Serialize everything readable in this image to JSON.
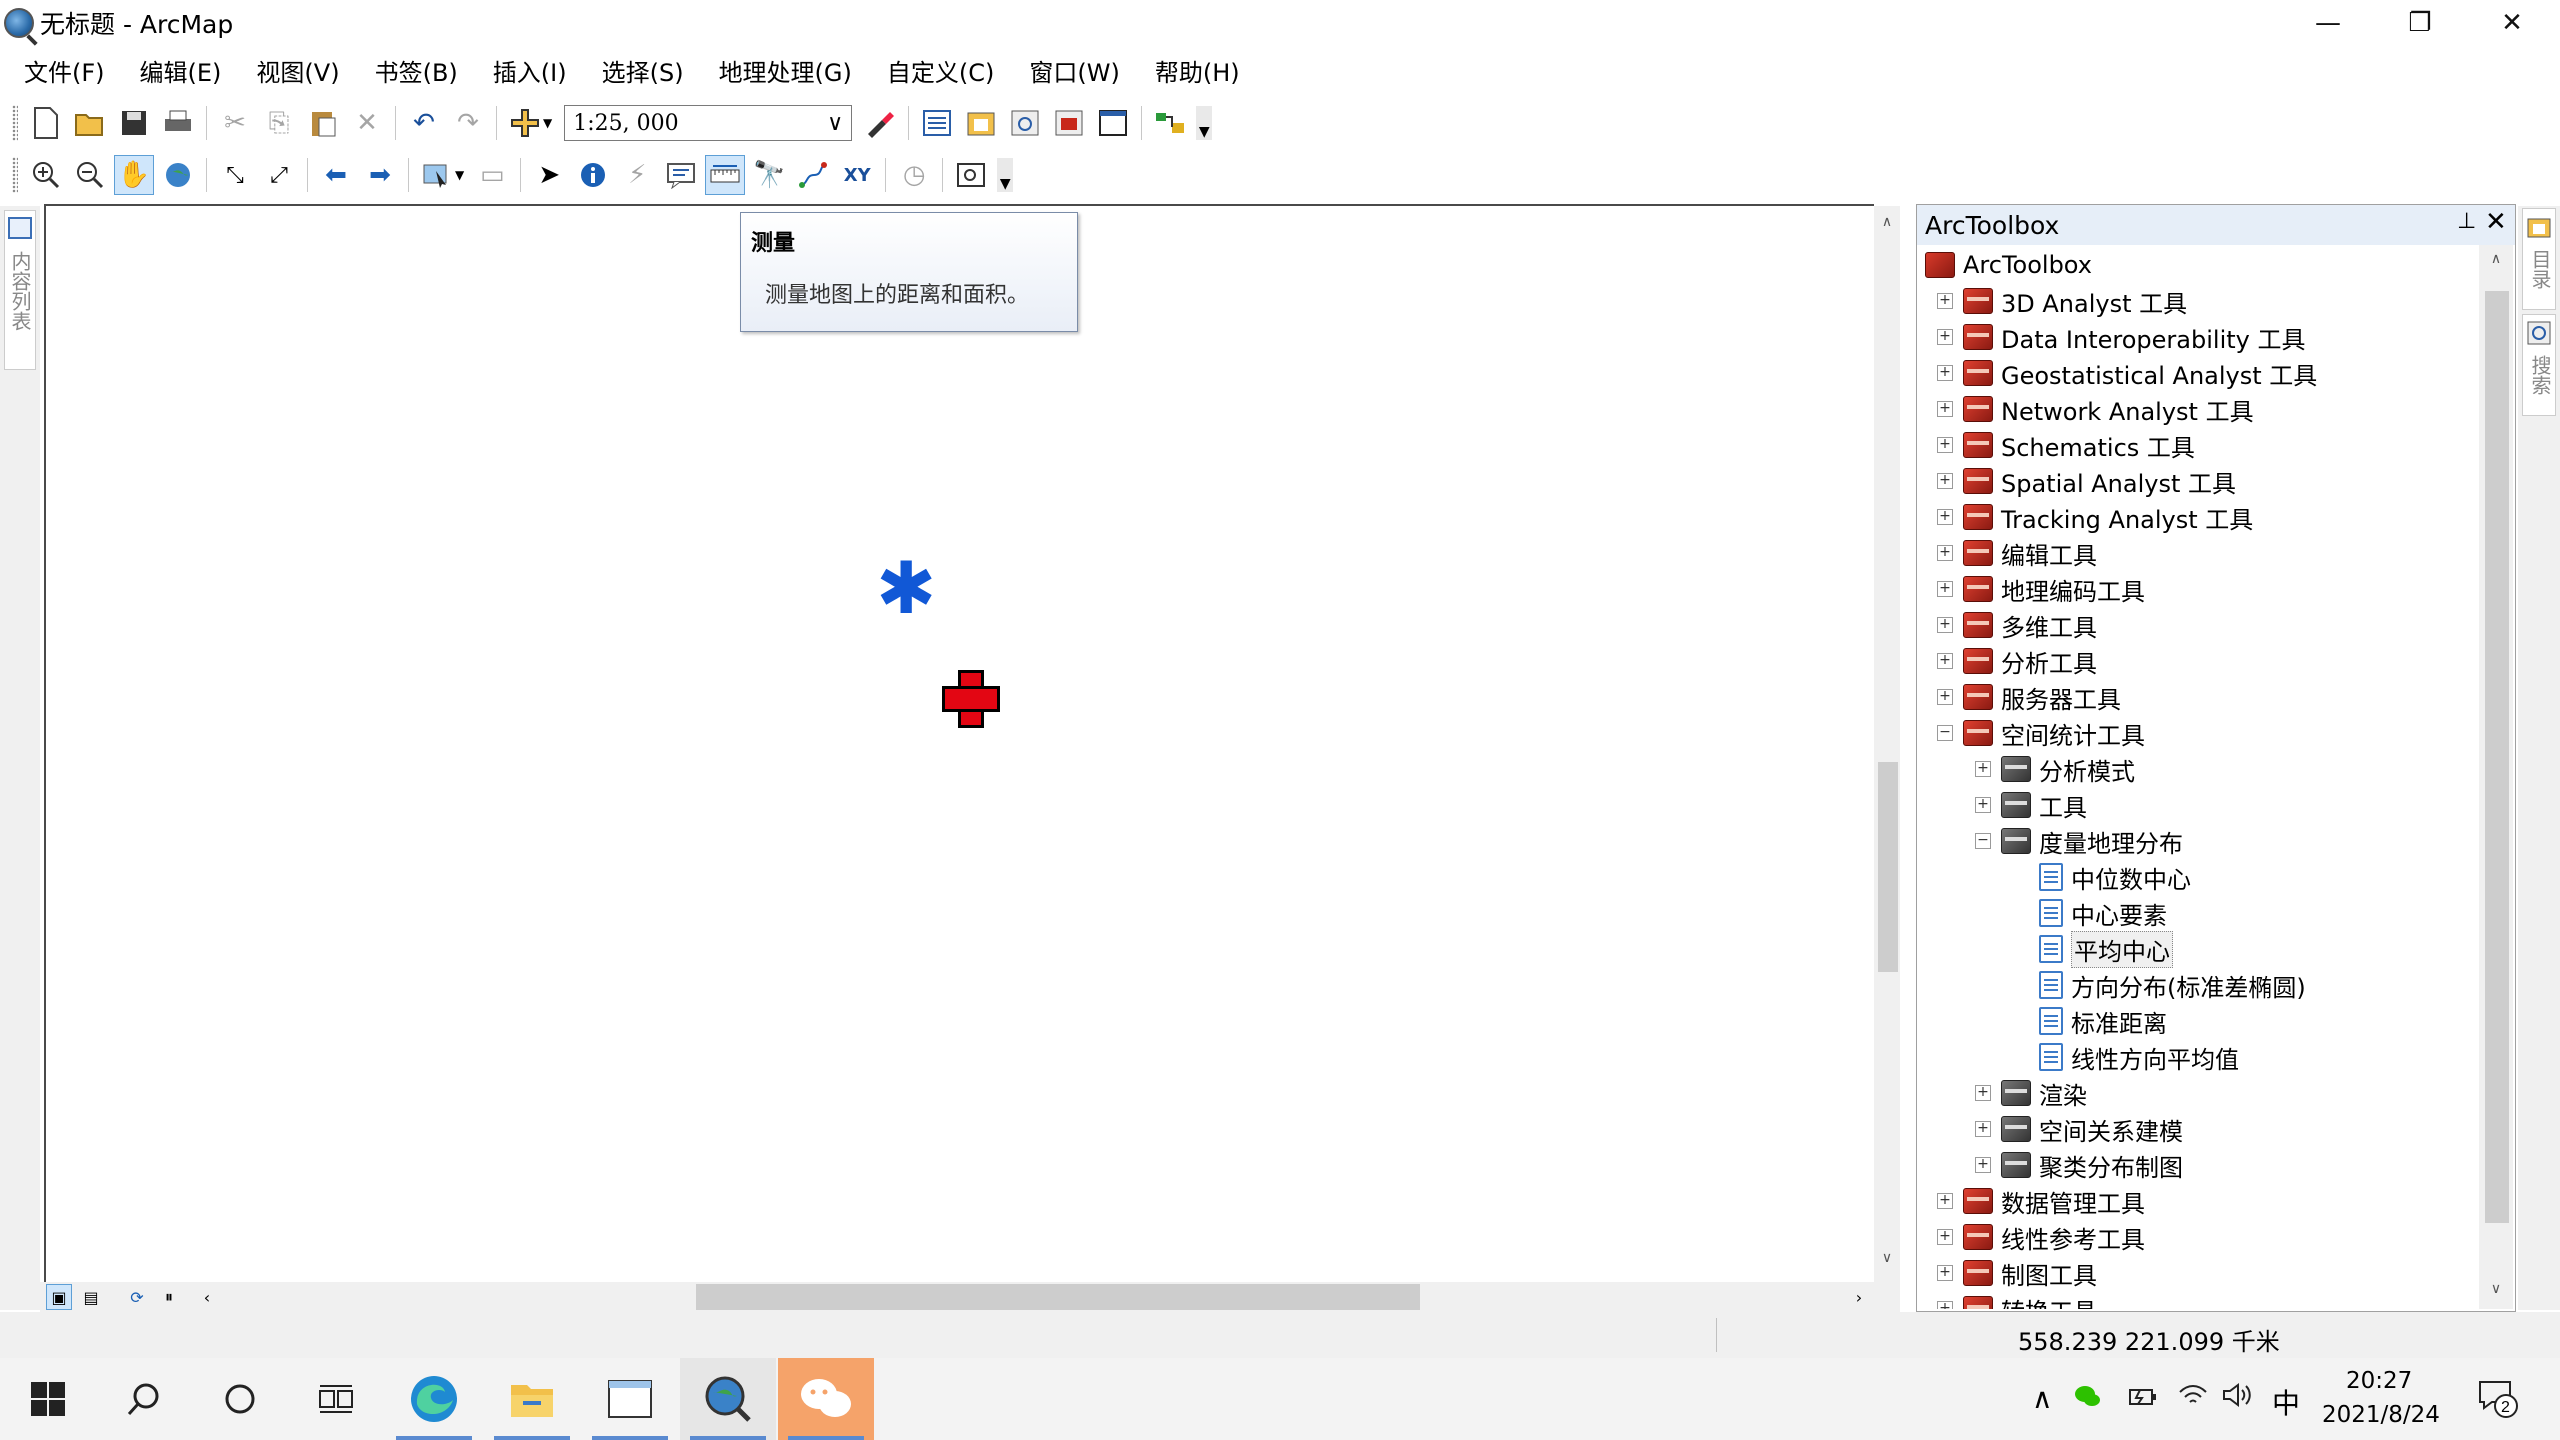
{
  "window": {
    "title": "无标题 - ArcMap",
    "minimize_glyph": "—",
    "restore_glyph": "❐",
    "close_glyph": "✕"
  },
  "menu": [
    "文件(F)",
    "编辑(E)",
    "视图(V)",
    "书签(B)",
    "插入(I)",
    "选择(S)",
    "地理处理(G)",
    "自定义(C)",
    "窗口(W)",
    "帮助(H)"
  ],
  "toolbar": {
    "scale_value": "1:25, 000",
    "scale_dropdown_glyph": "∨"
  },
  "tooltip": {
    "title": "测量",
    "text": "测量地图上的距离和面积。"
  },
  "map": {
    "asterisk_glyph": "✱",
    "asterisk_color": "#1158d6",
    "cross_color": "#e30613"
  },
  "toolbox": {
    "header": "ArcToolbox",
    "root_label": "ArcToolbox",
    "items": [
      {
        "label": "3D Analyst 工具",
        "expander": "+"
      },
      {
        "label": "Data Interoperability 工具",
        "expander": "+"
      },
      {
        "label": "Geostatistical Analyst 工具",
        "expander": "+"
      },
      {
        "label": "Network Analyst 工具",
        "expander": "+"
      },
      {
        "label": "Schematics 工具",
        "expander": "+"
      },
      {
        "label": "Spatial Analyst 工具",
        "expander": "+"
      },
      {
        "label": "Tracking Analyst 工具",
        "expander": "+"
      },
      {
        "label": "编辑工具",
        "expander": "+"
      },
      {
        "label": "地理编码工具",
        "expander": "+"
      },
      {
        "label": "多维工具",
        "expander": "+"
      },
      {
        "label": "分析工具",
        "expander": "+"
      },
      {
        "label": "服务器工具",
        "expander": "+"
      },
      {
        "label": "空间统计工具",
        "expander": "−"
      }
    ],
    "spatial_stats_children": [
      {
        "label": "分析模式",
        "expander": "+"
      },
      {
        "label": "工具",
        "expander": "+"
      },
      {
        "label": "度量地理分布",
        "expander": "−"
      }
    ],
    "geo_dist_tools": [
      "中位数中心",
      "中心要素",
      "平均中心",
      "方向分布(标准差椭圆)",
      "标准距离",
      "线性方向平均值"
    ],
    "selected_tool": "平均中心",
    "spatial_stats_more": [
      {
        "label": "渲染",
        "expander": "+"
      },
      {
        "label": "空间关系建模",
        "expander": "+"
      },
      {
        "label": "聚类分布制图",
        "expander": "+"
      }
    ],
    "after_items": [
      {
        "label": "数据管理工具",
        "expander": "+"
      },
      {
        "label": "线性参考工具",
        "expander": "+"
      },
      {
        "label": "制图工具",
        "expander": "+"
      },
      {
        "label": "转换工具",
        "expander": "+"
      }
    ],
    "pin_glyph": "📌",
    "close_glyph": "✕"
  },
  "left_dock": {
    "toc_tab_label": "内容列表"
  },
  "right_dock": {
    "catalog_tab_label": "目录",
    "search_tab_label": "搜索"
  },
  "status": {
    "coordinates": "558.239  221.099 千米"
  },
  "taskbar": {
    "start_glyph": "⊞",
    "search_glyph": "⌕",
    "cortana_glyph": "○",
    "taskview_glyph": "⧉",
    "tray_expand": "∧",
    "ime": "中",
    "time": "20:27",
    "date": "2021/8/24",
    "notification_count": "2"
  }
}
